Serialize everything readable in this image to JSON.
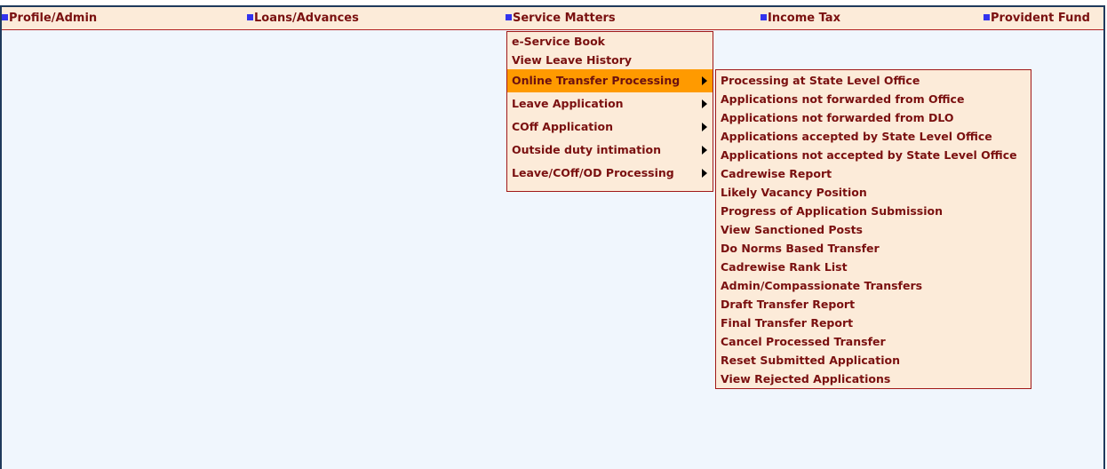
{
  "menubar": {
    "items": [
      {
        "label": "Profile/Admin"
      },
      {
        "label": "Loans/Advances"
      },
      {
        "label": "Service Matters"
      },
      {
        "label": "Income Tax"
      },
      {
        "label": "Provident Fund"
      }
    ]
  },
  "service_matters_menu": {
    "items": [
      {
        "label": "e-Service Book"
      },
      {
        "label": "View Leave History"
      },
      {
        "label": "Online Transfer Processing",
        "submenu": true,
        "active": true
      },
      {
        "label": "Leave Application",
        "submenu": true
      },
      {
        "label": "COff Application",
        "submenu": true
      },
      {
        "label": "Outside duty intimation",
        "submenu": true
      },
      {
        "label": "Leave/COff/OD Processing",
        "submenu": true
      }
    ]
  },
  "transfer_submenu": {
    "items": [
      {
        "label": "Processing at State Level Office"
      },
      {
        "label": "Applications not forwarded from Office"
      },
      {
        "label": "Applications not forwarded from DLO"
      },
      {
        "label": "Applications accepted by State Level Office"
      },
      {
        "label": "Applications not accepted by State Level Office"
      },
      {
        "label": "Cadrewise Report"
      },
      {
        "label": "Likely Vacancy Position"
      },
      {
        "label": "Progress of Application Submission"
      },
      {
        "label": "View Sanctioned Posts"
      },
      {
        "label": "Do Norms Based Transfer"
      },
      {
        "label": "Cadrewise Rank List"
      },
      {
        "label": "Admin/Compassionate Transfers"
      },
      {
        "label": "Draft Transfer Report"
      },
      {
        "label": "Final Transfer Report"
      },
      {
        "label": "Cancel Processed Transfer"
      },
      {
        "label": "Reset Submitted Application"
      },
      {
        "label": "View Rejected Applications"
      }
    ]
  },
  "colors": {
    "menu_bg": "#fcebd9",
    "menu_text": "#7a1010",
    "active_bg": "#ff9a00",
    "page_bg": "#f0f6fd",
    "bullet": "#3333ee"
  },
  "icons": {
    "bullet": "menu-bullet-icon",
    "submenu_arrow": "chevron-right-icon"
  }
}
